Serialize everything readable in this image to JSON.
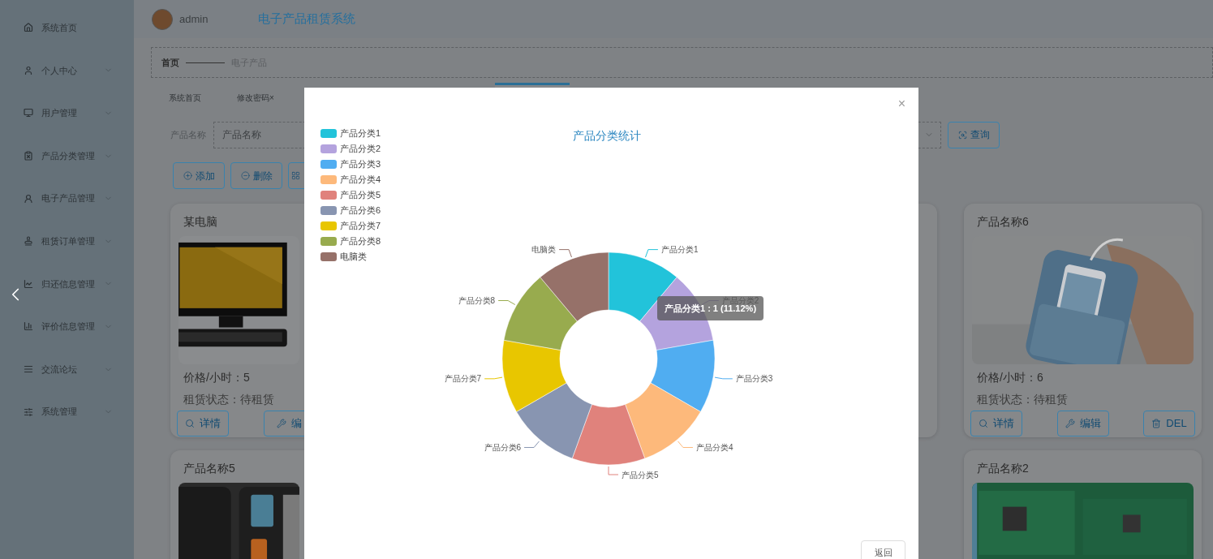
{
  "sidebar": {
    "items": [
      {
        "label": "系统首页",
        "kind": "link"
      },
      {
        "label": "个人中心",
        "kind": "submenu"
      },
      {
        "label": "用户管理",
        "kind": "submenu"
      },
      {
        "label": "产品分类管理",
        "kind": "submenu"
      },
      {
        "label": "电子产品管理",
        "kind": "submenu"
      },
      {
        "label": "租赁订单管理",
        "kind": "submenu"
      },
      {
        "label": "归还信息管理",
        "kind": "submenu"
      },
      {
        "label": "评价信息管理",
        "kind": "submenu"
      },
      {
        "label": "交流论坛",
        "kind": "submenu"
      },
      {
        "label": "系统管理",
        "kind": "submenu"
      }
    ]
  },
  "header": {
    "user": "admin",
    "title": "电子产品租赁系统"
  },
  "breadcrumb": {
    "home": "首页",
    "current": "电子产品"
  },
  "tabs": [
    {
      "label": "系统首页",
      "selected": false
    },
    {
      "label": "修改密码×",
      "selected": false
    },
    {
      "selected": true
    }
  ],
  "search": {
    "label": "产品名称",
    "placeholder": "产品名称",
    "query_button": "查询"
  },
  "toolbar": [
    {
      "kind": "text",
      "label": "添加"
    },
    {
      "kind": "text",
      "label": "删除"
    },
    {
      "kind": "icon"
    }
  ],
  "cards": [
    {
      "title": "某电脑",
      "price": "价格/小时：5",
      "status": "租赁状态：待租赁",
      "buttons": [
        "详情",
        "编"
      ]
    },
    {
      "title": "产品名称6",
      "price": "价格/小时：6",
      "status": "租赁状态：待租赁",
      "buttons": [
        "详情",
        "编辑",
        "DEL"
      ]
    },
    {
      "title": "产品名称5"
    },
    {
      "title": "产品名称2"
    }
  ],
  "modal": {
    "legend": [
      {
        "label": "产品分类1",
        "color": "#22c3da"
      },
      {
        "label": "产品分类2",
        "color": "#b4a3de"
      },
      {
        "label": "产品分类3",
        "color": "#50adf1"
      },
      {
        "label": "产品分类4",
        "color": "#fdb97b"
      },
      {
        "label": "产品分类5",
        "color": "#e0827c"
      },
      {
        "label": "产品分类6",
        "color": "#8895b1"
      },
      {
        "label": "产品分类7",
        "color": "#e8c600"
      },
      {
        "label": "产品分类8",
        "color": "#98ab4e"
      },
      {
        "label": "电脑类",
        "color": "#967169"
      }
    ],
    "chart_data": {
      "type": "donut",
      "title": "产品分类统计",
      "categories": [
        "产品分类1",
        "产品分类2",
        "产品分类3",
        "产品分类4",
        "产品分类5",
        "产品分类6",
        "产品分类7",
        "产品分类8",
        "电脑类"
      ],
      "values": [
        1,
        1,
        1,
        1,
        1,
        1,
        1,
        1,
        1
      ],
      "colors": [
        "#22c3da",
        "#b4a3de",
        "#50adf1",
        "#fdb97b",
        "#e0827c",
        "#8895b1",
        "#e8c600",
        "#98ab4e",
        "#967169"
      ]
    },
    "tooltip": "产品分类1 : 1 (11.12%)",
    "close": "×",
    "back_button": "返回"
  }
}
